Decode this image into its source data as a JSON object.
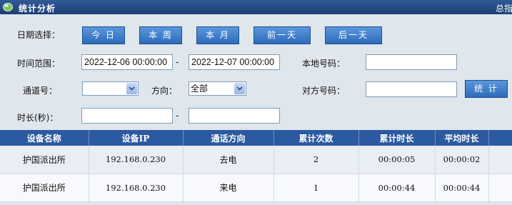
{
  "header": {
    "title": "统计分析",
    "right_text": "总指"
  },
  "form": {
    "date_select_label": "日期选择：",
    "date_buttons": [
      "今 日",
      "本 周",
      "本 月",
      "前一天",
      "后一天"
    ],
    "time_range_label": "时间范围：",
    "time_start": "2022-12-06 00:00:00",
    "time_end": "2022-12-07 00:00:00",
    "range_sep": "-",
    "local_number_label": "本地号码：",
    "local_number": "",
    "channel_label": "通道号：",
    "channel_value": "",
    "direction_label": "方向：",
    "direction_value": "全部",
    "remote_number_label": "对方号码：",
    "remote_number": "",
    "stats_button": "统 计",
    "duration_label": "时长(秒)：",
    "duration_min": "",
    "duration_sep": "-",
    "duration_max": ""
  },
  "table": {
    "columns": [
      "设备名称",
      "设备IP",
      "通话方向",
      "累计次数",
      "累计时长",
      "平均时长"
    ],
    "rows": [
      [
        "护国派出所",
        "192.168.0.230",
        "去电",
        "2",
        "00:00:05",
        "00:00:02"
      ],
      [
        "护国派出所",
        "192.168.0.230",
        "来电",
        "1",
        "00:00:44",
        "00:00:44"
      ]
    ]
  },
  "icons": {
    "title_icon": "globe-icon",
    "dropdown": "chevron-down-icon"
  },
  "colors": {
    "header_bg": "#2c5aa0",
    "button_bg": "#3f7fcf",
    "panel_bg": "#dfe6ec"
  }
}
